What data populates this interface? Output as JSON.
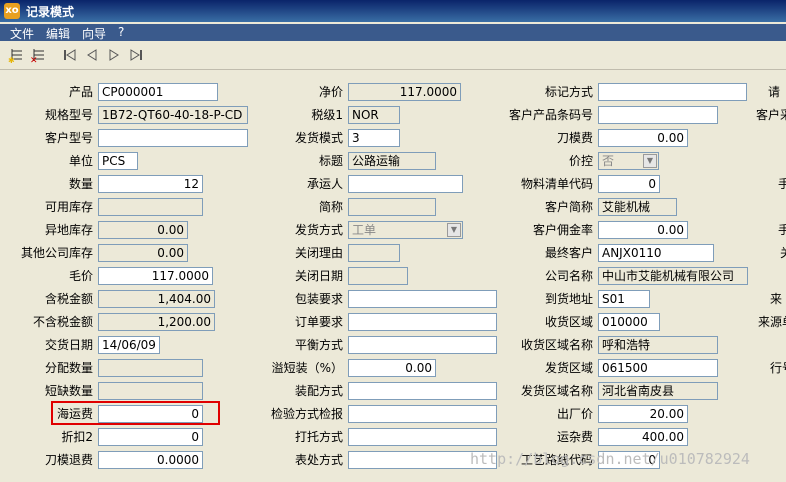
{
  "window": {
    "title": "记录模式",
    "icon_text": "xo"
  },
  "menu": [
    "文件",
    "编辑",
    "向导",
    "?"
  ],
  "toolbar": [
    "insert-record-icon",
    "delete-record-icon",
    "first-record-icon",
    "prev-record-icon",
    "next-record-icon",
    "last-record-icon"
  ],
  "col1": [
    {
      "label": "产品",
      "value": "CP000001"
    },
    {
      "label": "规格型号",
      "value": "1B72-QT60-40-18-P-CD"
    },
    {
      "label": "客户型号",
      "value": ""
    },
    {
      "label": "单位",
      "value": "PCS"
    },
    {
      "label": "数量",
      "value": "12"
    },
    {
      "label": "可用库存",
      "value": ""
    },
    {
      "label": "异地库存",
      "value": "0.00"
    },
    {
      "label": "其他公司库存",
      "value": "0.00"
    },
    {
      "label": "毛价",
      "value": "117.0000"
    },
    {
      "label": "含税金额",
      "value": "1,404.00"
    },
    {
      "label": "不含税金额",
      "value": "1,200.00"
    },
    {
      "label": "交货日期",
      "value": "14/06/09"
    },
    {
      "label": "分配数量",
      "value": ""
    },
    {
      "label": "短缺数量",
      "value": ""
    },
    {
      "label": "海运费",
      "value": "0"
    },
    {
      "label": "折扣2",
      "value": "0"
    },
    {
      "label": "刀模退费",
      "value": "0.0000"
    }
  ],
  "col2": [
    {
      "label": "净价",
      "value": "117.0000"
    },
    {
      "label": "税级1",
      "value": "NOR"
    },
    {
      "label": "发货模式",
      "value": "3"
    },
    {
      "label": "标题",
      "value": "公路运输"
    },
    {
      "label": "承运人",
      "value": ""
    },
    {
      "label": "简称",
      "value": ""
    },
    {
      "label": "发货方式",
      "value": "工单"
    },
    {
      "label": "关闭理由",
      "value": ""
    },
    {
      "label": "关闭日期",
      "value": ""
    },
    {
      "label": "包装要求",
      "value": ""
    },
    {
      "label": "订单要求",
      "value": ""
    },
    {
      "label": "平衡方式",
      "value": ""
    },
    {
      "label": "溢短装（%）",
      "value": "0.00"
    },
    {
      "label": "装配方式",
      "value": ""
    },
    {
      "label": "检验方式检报",
      "value": ""
    },
    {
      "label": "打托方式",
      "value": ""
    },
    {
      "label": "表处方式",
      "value": ""
    }
  ],
  "col3": [
    {
      "label": "标记方式",
      "value": ""
    },
    {
      "label": "客户产品条码号",
      "value": ""
    },
    {
      "label": "刀模费",
      "value": "0.00"
    },
    {
      "label": "价控",
      "value": "否"
    },
    {
      "label": "物料清单代码",
      "value": "0"
    },
    {
      "label": "客户简称",
      "value": "艾能机械"
    },
    {
      "label": "客户佣金率",
      "value": "0.00"
    },
    {
      "label": "最终客户",
      "value": "ANJX0110"
    },
    {
      "label": "公司名称",
      "value": "中山市艾能机械有限公司"
    },
    {
      "label": "到货地址",
      "value": "S01"
    },
    {
      "label": "收货区域",
      "value": "010000"
    },
    {
      "label": "收货区域名称",
      "value": "呼和浩特"
    },
    {
      "label": "发货区域",
      "value": "061500"
    },
    {
      "label": "发货区域名称",
      "value": "河北省南皮县"
    },
    {
      "label": "出厂价",
      "value": "20.00"
    },
    {
      "label": "运杂费",
      "value": "400.00"
    },
    {
      "label": "工艺路线代码",
      "value": "0"
    }
  ],
  "col4": [
    {
      "label": "请"
    },
    {
      "label": "客户采"
    },
    {
      "label": "手"
    },
    {
      "label": "手"
    },
    {
      "label": "关"
    },
    {
      "label": "来"
    },
    {
      "label": "来源单"
    },
    {
      "label": "行号"
    }
  ],
  "watermark": "http://blog.csdn.net/u010782924"
}
